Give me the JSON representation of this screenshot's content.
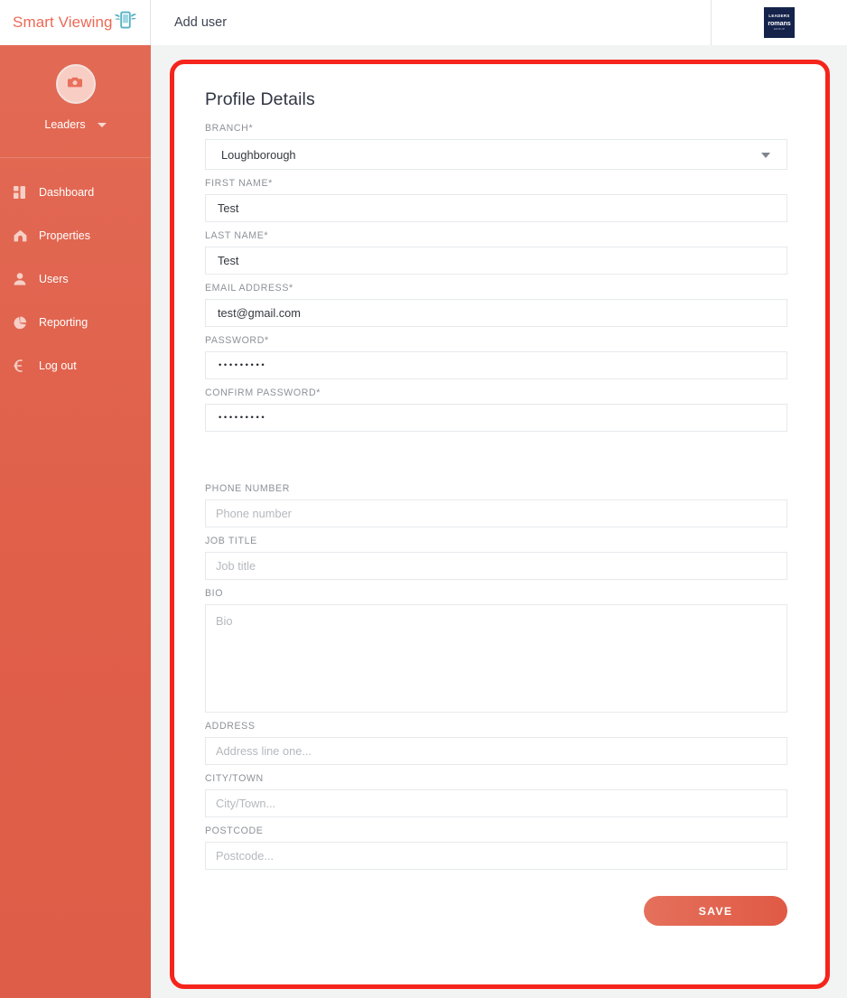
{
  "header": {
    "brand_name": "Smart Viewing",
    "brand_icon": "winged-phone-icon",
    "page_title": "Add user",
    "logo": {
      "line1": "LEADERS",
      "line2": "romans",
      "line3": "GROUP"
    }
  },
  "sidebar": {
    "avatar_icon": "camera-icon",
    "account_name": "Leaders",
    "items": [
      {
        "label": "Dashboard",
        "icon": "dashboard-icon"
      },
      {
        "label": "Properties",
        "icon": "home-icon"
      },
      {
        "label": "Users",
        "icon": "user-icon"
      },
      {
        "label": "Reporting",
        "icon": "pie-chart-icon"
      },
      {
        "label": "Log out",
        "icon": "logout-icon"
      }
    ]
  },
  "form": {
    "title": "Profile Details",
    "fields": {
      "branch": {
        "label": "BRANCH*",
        "value": "Loughborough"
      },
      "first_name": {
        "label": "FIRST NAME*",
        "value": "Test"
      },
      "last_name": {
        "label": "LAST NAME*",
        "value": "Test"
      },
      "email": {
        "label": "EMAIL ADDRESS*",
        "value": "test@gmail.com"
      },
      "password": {
        "label": "PASSWORD*",
        "value": "•••••••••"
      },
      "confirm_password": {
        "label": "CONFIRM PASSWORD*",
        "value": "•••••••••"
      },
      "phone": {
        "label": "PHONE NUMBER",
        "placeholder": "Phone number",
        "value": ""
      },
      "job_title": {
        "label": "JOB TITLE",
        "placeholder": "Job title",
        "value": ""
      },
      "bio": {
        "label": "BIO",
        "placeholder": "Bio",
        "value": ""
      },
      "address": {
        "label": "ADDRESS",
        "placeholder": "Address line one...",
        "value": ""
      },
      "city": {
        "label": "CITY/TOWN",
        "placeholder": "City/Town...",
        "value": ""
      },
      "postcode": {
        "label": "POSTCODE",
        "placeholder": "Postcode...",
        "value": ""
      }
    },
    "save_label": "SAVE"
  },
  "colors": {
    "sidebar": "#e0614c",
    "brand": "#ec6a56",
    "card_border": "#f5241c",
    "logo_navy": "#15234b",
    "label_gray": "#8d9298",
    "placeholder_gray": "#b4b9be"
  }
}
